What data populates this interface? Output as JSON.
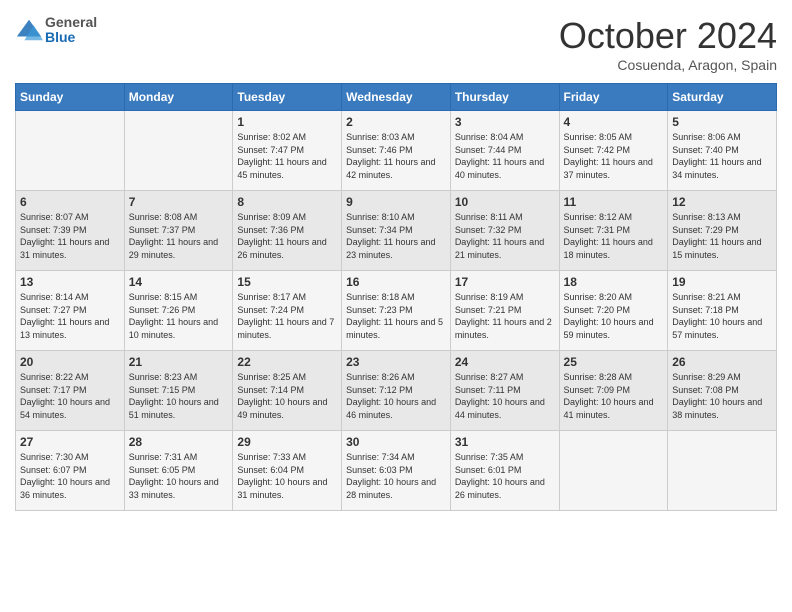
{
  "logo": {
    "general": "General",
    "blue": "Blue"
  },
  "title": "October 2024",
  "subtitle": "Cosuenda, Aragon, Spain",
  "days_header": [
    "Sunday",
    "Monday",
    "Tuesday",
    "Wednesday",
    "Thursday",
    "Friday",
    "Saturday"
  ],
  "weeks": [
    [
      {
        "num": "",
        "info": ""
      },
      {
        "num": "",
        "info": ""
      },
      {
        "num": "1",
        "info": "Sunrise: 8:02 AM\nSunset: 7:47 PM\nDaylight: 11 hours and 45 minutes."
      },
      {
        "num": "2",
        "info": "Sunrise: 8:03 AM\nSunset: 7:46 PM\nDaylight: 11 hours and 42 minutes."
      },
      {
        "num": "3",
        "info": "Sunrise: 8:04 AM\nSunset: 7:44 PM\nDaylight: 11 hours and 40 minutes."
      },
      {
        "num": "4",
        "info": "Sunrise: 8:05 AM\nSunset: 7:42 PM\nDaylight: 11 hours and 37 minutes."
      },
      {
        "num": "5",
        "info": "Sunrise: 8:06 AM\nSunset: 7:40 PM\nDaylight: 11 hours and 34 minutes."
      }
    ],
    [
      {
        "num": "6",
        "info": "Sunrise: 8:07 AM\nSunset: 7:39 PM\nDaylight: 11 hours and 31 minutes."
      },
      {
        "num": "7",
        "info": "Sunrise: 8:08 AM\nSunset: 7:37 PM\nDaylight: 11 hours and 29 minutes."
      },
      {
        "num": "8",
        "info": "Sunrise: 8:09 AM\nSunset: 7:36 PM\nDaylight: 11 hours and 26 minutes."
      },
      {
        "num": "9",
        "info": "Sunrise: 8:10 AM\nSunset: 7:34 PM\nDaylight: 11 hours and 23 minutes."
      },
      {
        "num": "10",
        "info": "Sunrise: 8:11 AM\nSunset: 7:32 PM\nDaylight: 11 hours and 21 minutes."
      },
      {
        "num": "11",
        "info": "Sunrise: 8:12 AM\nSunset: 7:31 PM\nDaylight: 11 hours and 18 minutes."
      },
      {
        "num": "12",
        "info": "Sunrise: 8:13 AM\nSunset: 7:29 PM\nDaylight: 11 hours and 15 minutes."
      }
    ],
    [
      {
        "num": "13",
        "info": "Sunrise: 8:14 AM\nSunset: 7:27 PM\nDaylight: 11 hours and 13 minutes."
      },
      {
        "num": "14",
        "info": "Sunrise: 8:15 AM\nSunset: 7:26 PM\nDaylight: 11 hours and 10 minutes."
      },
      {
        "num": "15",
        "info": "Sunrise: 8:17 AM\nSunset: 7:24 PM\nDaylight: 11 hours and 7 minutes."
      },
      {
        "num": "16",
        "info": "Sunrise: 8:18 AM\nSunset: 7:23 PM\nDaylight: 11 hours and 5 minutes."
      },
      {
        "num": "17",
        "info": "Sunrise: 8:19 AM\nSunset: 7:21 PM\nDaylight: 11 hours and 2 minutes."
      },
      {
        "num": "18",
        "info": "Sunrise: 8:20 AM\nSunset: 7:20 PM\nDaylight: 10 hours and 59 minutes."
      },
      {
        "num": "19",
        "info": "Sunrise: 8:21 AM\nSunset: 7:18 PM\nDaylight: 10 hours and 57 minutes."
      }
    ],
    [
      {
        "num": "20",
        "info": "Sunrise: 8:22 AM\nSunset: 7:17 PM\nDaylight: 10 hours and 54 minutes."
      },
      {
        "num": "21",
        "info": "Sunrise: 8:23 AM\nSunset: 7:15 PM\nDaylight: 10 hours and 51 minutes."
      },
      {
        "num": "22",
        "info": "Sunrise: 8:25 AM\nSunset: 7:14 PM\nDaylight: 10 hours and 49 minutes."
      },
      {
        "num": "23",
        "info": "Sunrise: 8:26 AM\nSunset: 7:12 PM\nDaylight: 10 hours and 46 minutes."
      },
      {
        "num": "24",
        "info": "Sunrise: 8:27 AM\nSunset: 7:11 PM\nDaylight: 10 hours and 44 minutes."
      },
      {
        "num": "25",
        "info": "Sunrise: 8:28 AM\nSunset: 7:09 PM\nDaylight: 10 hours and 41 minutes."
      },
      {
        "num": "26",
        "info": "Sunrise: 8:29 AM\nSunset: 7:08 PM\nDaylight: 10 hours and 38 minutes."
      }
    ],
    [
      {
        "num": "27",
        "info": "Sunrise: 7:30 AM\nSunset: 6:07 PM\nDaylight: 10 hours and 36 minutes."
      },
      {
        "num": "28",
        "info": "Sunrise: 7:31 AM\nSunset: 6:05 PM\nDaylight: 10 hours and 33 minutes."
      },
      {
        "num": "29",
        "info": "Sunrise: 7:33 AM\nSunset: 6:04 PM\nDaylight: 10 hours and 31 minutes."
      },
      {
        "num": "30",
        "info": "Sunrise: 7:34 AM\nSunset: 6:03 PM\nDaylight: 10 hours and 28 minutes."
      },
      {
        "num": "31",
        "info": "Sunrise: 7:35 AM\nSunset: 6:01 PM\nDaylight: 10 hours and 26 minutes."
      },
      {
        "num": "",
        "info": ""
      },
      {
        "num": "",
        "info": ""
      }
    ]
  ]
}
